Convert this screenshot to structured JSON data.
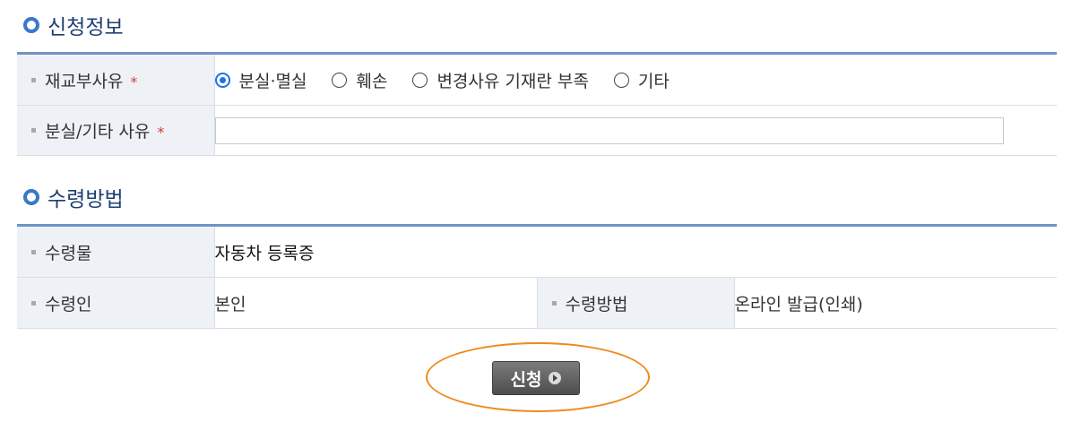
{
  "application_info": {
    "title": "신청정보",
    "reason": {
      "label": "재교부사유",
      "required_mark": "*",
      "options": [
        {
          "label": "분실·멸실",
          "checked": true
        },
        {
          "label": "훼손",
          "checked": false
        },
        {
          "label": "변경사유 기재란 부족",
          "checked": false
        },
        {
          "label": "기타",
          "checked": false
        }
      ]
    },
    "detail": {
      "label": "분실/기타 사유",
      "required_mark": "*",
      "value": ""
    }
  },
  "receipt": {
    "title": "수령방법",
    "item": {
      "label": "수령물",
      "value": "자동차 등록증"
    },
    "recipient": {
      "label": "수령인",
      "value": "본인"
    },
    "method": {
      "label": "수령방법",
      "value": "온라인 발급(인쇄)"
    }
  },
  "submit": {
    "label": "신청",
    "icon": "arrow-right-icon"
  },
  "colors": {
    "section_title": "#1f3f73",
    "table_border_top": "#6e94c6",
    "header_bg": "#eef2f7",
    "required": "#d93b3b",
    "radio_checked": "#1a73e8",
    "highlight": "#f08a1f"
  }
}
